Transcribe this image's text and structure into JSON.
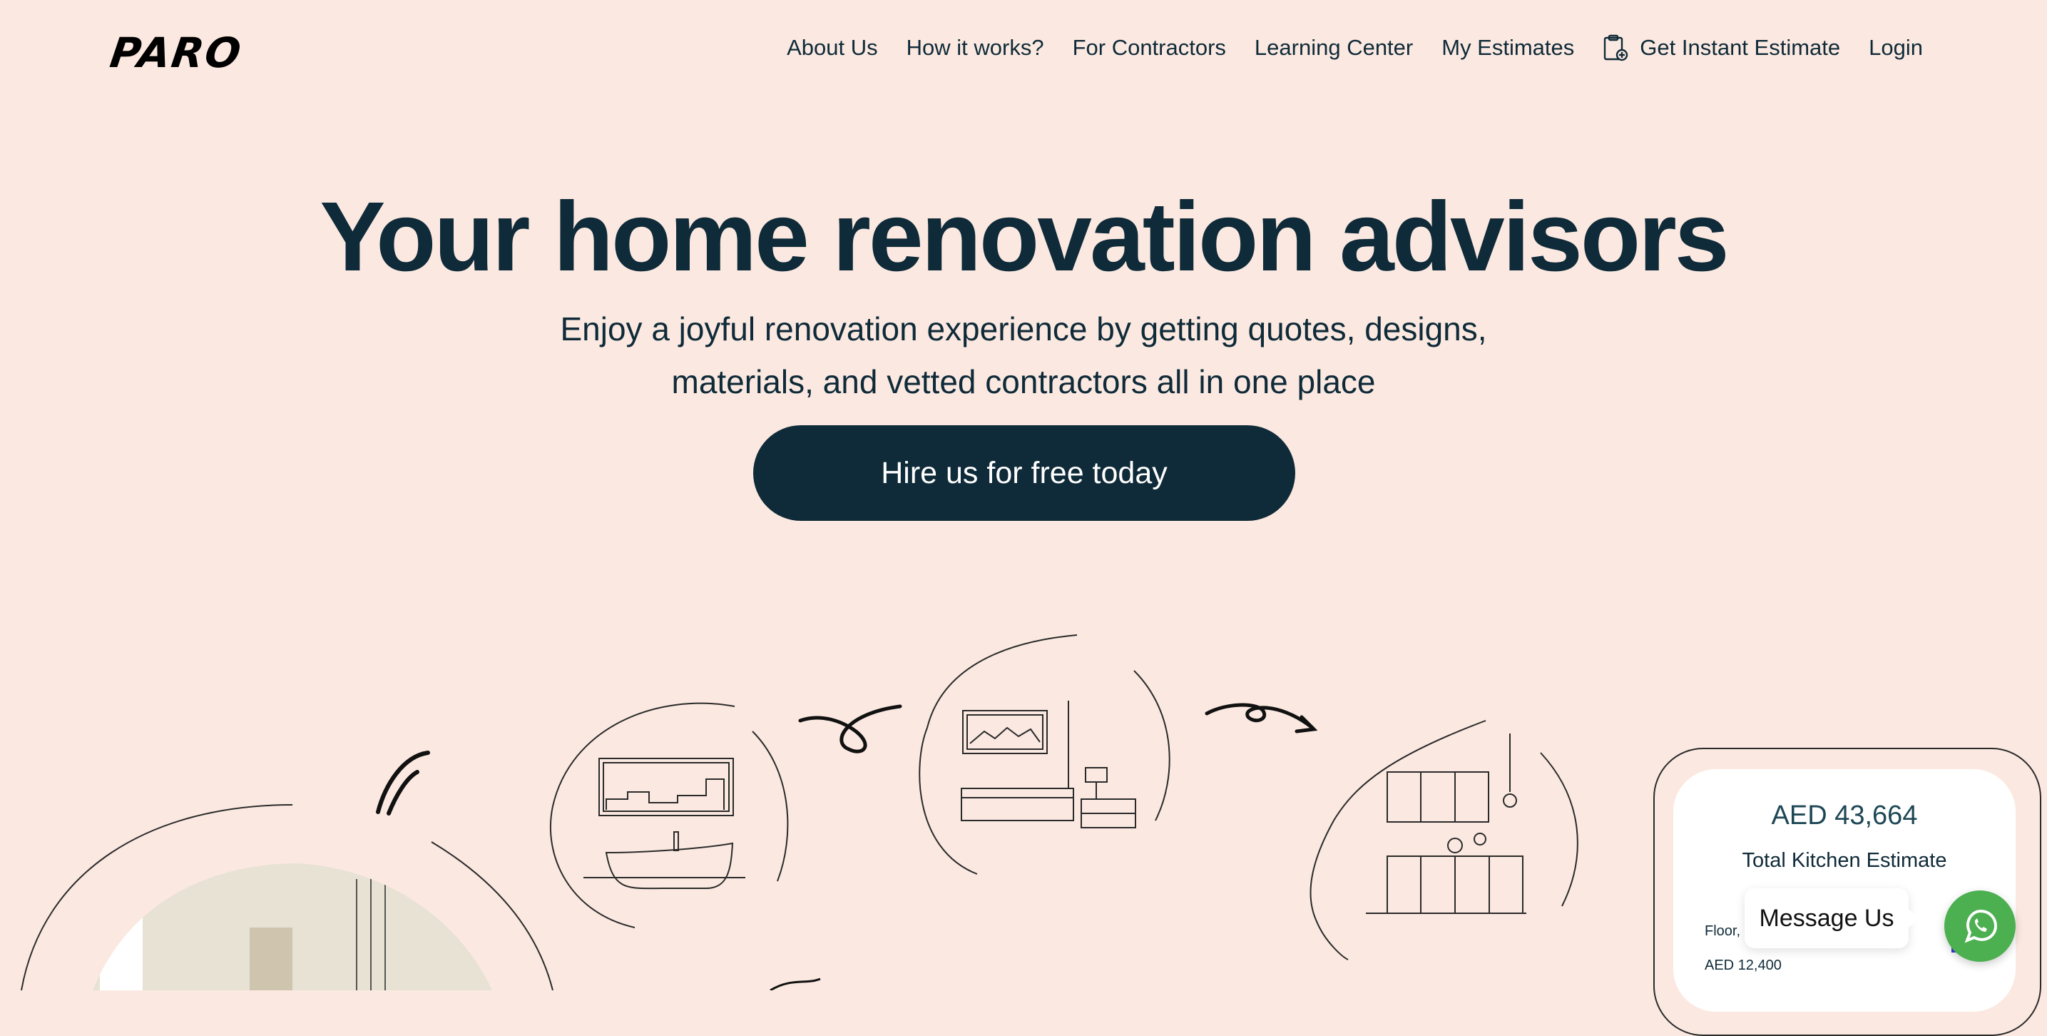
{
  "brand": {
    "logo": "PARO"
  },
  "nav": {
    "items": [
      "About Us",
      "How it works?",
      "For Contractors",
      "Learning Center",
      "My Estimates"
    ],
    "estimate_label": "Get Instant Estimate",
    "login_label": "Login"
  },
  "hero": {
    "title": "Your home renovation advisors",
    "subtitle_line1": "Enjoy a joyful renovation experience by getting quotes, designs,",
    "subtitle_line2": "materials, and vetted contractors all in one place",
    "cta_label": "Hire us for free today"
  },
  "estimate_card": {
    "amount": "AED 43,664",
    "label": "Total Kitchen Estimate",
    "line1": "Floor,",
    "line2": "AED 12,400"
  },
  "chat": {
    "message_label": "Message Us",
    "icon": "whatsapp-icon"
  },
  "colors": {
    "background": "#fbe9e1",
    "primary": "#0f2a38",
    "whatsapp": "#4caf50"
  }
}
